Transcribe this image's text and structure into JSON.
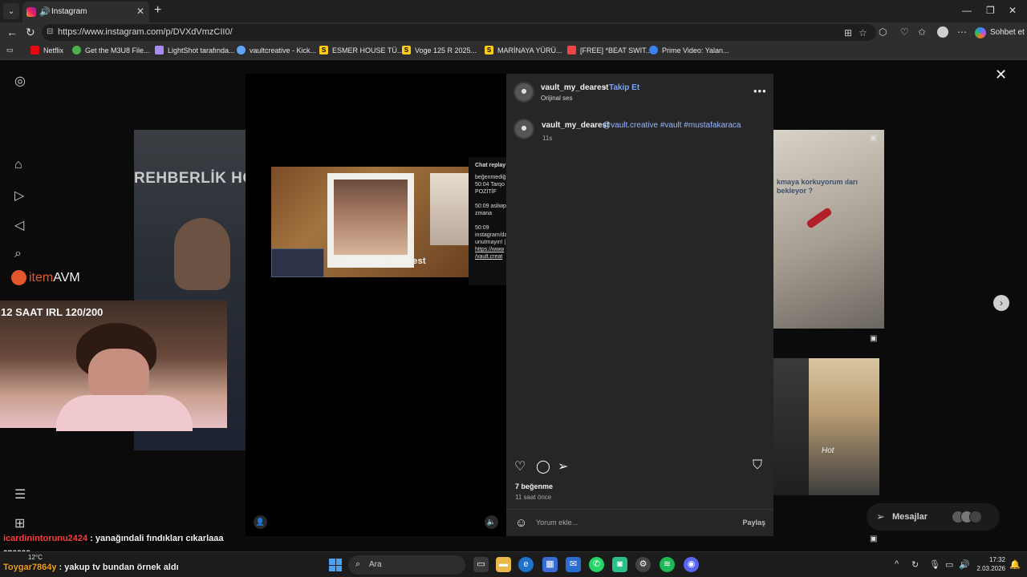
{
  "browser": {
    "tab_title": "Instagram",
    "url": "https://www.instagram.com/p/DVXdVmzCII0/",
    "copilot_label": "Sohbet et",
    "bookmarks": [
      {
        "label": "Netflix",
        "color": "#e50914"
      },
      {
        "label": "Get the M3U8 File...",
        "color": "#4caf50"
      },
      {
        "label": "LightShot tarafında...",
        "color": "#a78bfa"
      },
      {
        "label": "vaultcreative - Kick...",
        "color": "#60a5fa"
      },
      {
        "label": "ESMER HOUSE TÜ...",
        "color": "#facc15"
      },
      {
        "label": "Voge 125 R 2025...",
        "color": "#facc15"
      },
      {
        "label": "MARİNAYA YÜRÜ...",
        "color": "#facc15"
      },
      {
        "label": "[FREE] *BEAT SWIT...",
        "color": "#ef4444"
      },
      {
        "label": "Prime Video: Yalan...",
        "color": "#3b82f6"
      }
    ]
  },
  "background": {
    "rehber_text": "REHBERLİK HO",
    "right_text": "kmaya korkuyorum ıları bekleyor ?",
    "right3_text": "Hot"
  },
  "media": {
    "watermark": "Vault_my_dearest",
    "chat_header": "Chat replay",
    "chat_lines": [
      "beğenmediği",
      "",
      "50:04 Tarqo",
      "POZİTİF",
      "",
      "50:09 asliwp",
      "zmana",
      "",
      "50:09",
      "instagram/dan",
      "unutmayın! |",
      "https://www",
      "/vault.creat"
    ]
  },
  "post": {
    "username": "vault_my_dearest",
    "follow_label": "Takip Et",
    "audio": "Orijinal ses",
    "caption_tags": "@vault.creative #vault #mustafakaraca",
    "caption_time": "11s",
    "likes": "7 beğenme",
    "posted_ago": "11 saat önce",
    "comment_placeholder": "Yorum ekle...",
    "post_button": "Paylaş"
  },
  "messages_label": "Mesajlar",
  "stream": {
    "logo_text_a": "item",
    "logo_text_b": "AVM",
    "irl_title": "12 SAAT IRL 120/200",
    "chat": [
      {
        "user": "icardinintorunu2424",
        "text": " : yanağındali fındıkları cıkarlaaa"
      },
      {
        "user": "",
        "text": "anaaaa"
      },
      {
        "user": "Toygar7864y",
        "text": " : yakup tv bundan örnek aldı"
      }
    ]
  },
  "taskbar": {
    "search_label": "Ara",
    "time": "17:32",
    "date": "2.03.2026",
    "weather_temp": "12°C"
  }
}
